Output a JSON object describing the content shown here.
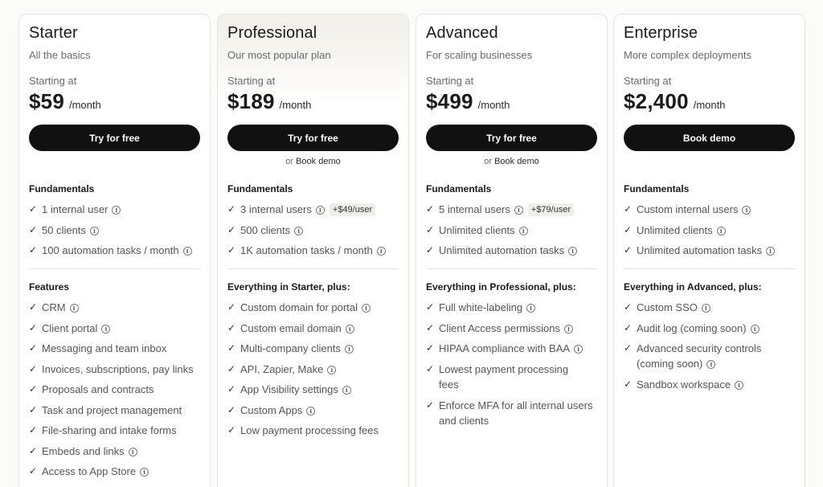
{
  "plans": [
    {
      "name": "Starter",
      "subtitle": "All the basics",
      "starting_label": "Starting at",
      "price": "$59",
      "period": "/month",
      "cta": "Try for free",
      "fundamentals_title": "Fundamentals",
      "fundamentals": [
        {
          "text": "1 internal user"
        },
        {
          "text": "50 clients"
        },
        {
          "text": "100 automation tasks / month"
        }
      ],
      "features_title": "Features",
      "features": [
        "CRM",
        "Client portal",
        "Messaging and team inbox",
        "Invoices, subscriptions, pay links",
        "Proposals and contracts",
        "Task and project management",
        "File-sharing and intake forms",
        "Embeds and links",
        "Access to App Store"
      ]
    },
    {
      "name": "Professional",
      "subtitle": "Our most popular plan",
      "starting_label": "Starting at",
      "price": "$189",
      "period": "/month",
      "cta": "Try for free",
      "demo_prefix": "or",
      "demo_link": "Book demo",
      "fundamentals_title": "Fundamentals",
      "fundamentals": [
        {
          "text": "3 internal users",
          "badge": "+$49/user"
        },
        {
          "text": "500 clients"
        },
        {
          "text": "1K automation tasks / month"
        }
      ],
      "features_title": "Everything in Starter, plus:",
      "features": [
        "Custom domain for portal",
        "Custom email domain",
        "Multi-company clients",
        "API, Zapier, Make",
        "App Visibility settings",
        "Custom Apps",
        "Low payment processing fees"
      ]
    },
    {
      "name": "Advanced",
      "subtitle": "For scaling businesses",
      "starting_label": "Starting at",
      "price": "$499",
      "period": "/month",
      "cta": "Try for free",
      "demo_prefix": "or",
      "demo_link": "Book demo",
      "fundamentals_title": "Fundamentals",
      "fundamentals": [
        {
          "text": "5 internal users",
          "badge": "+$79/user"
        },
        {
          "text": "Unlimited clients"
        },
        {
          "text": "Unlimited automation tasks"
        }
      ],
      "features_title": "Everything in Professional, plus:",
      "features": [
        "Full white-labeling",
        "Client Access permissions",
        "HIPAA compliance with BAA",
        "Lowest payment processing fees",
        "Enforce MFA for all internal users and clients"
      ]
    },
    {
      "name": "Enterprise",
      "subtitle": "More complex deployments",
      "starting_label": "Starting at",
      "price": "$2,400",
      "period": "/month",
      "cta": "Book demo",
      "fundamentals_title": "Fundamentals",
      "fundamentals": [
        {
          "text": "Custom internal users"
        },
        {
          "text": "Unlimited clients"
        },
        {
          "text": "Unlimited automation tasks"
        }
      ],
      "features_title": "Everything in Advanced, plus:",
      "features": [
        "Custom SSO",
        "Audit log (coming soon)",
        "Advanced security controls (coming soon)",
        "Sandbox workspace"
      ]
    }
  ],
  "icons": {
    "check": "checkmark-icon",
    "info": "info-circle-icon"
  },
  "colors": {
    "cta_bg": "#111111",
    "cta_text": "#ffffff",
    "badge_bg": "#efeee9",
    "popular_tint": "#f1efe8"
  }
}
